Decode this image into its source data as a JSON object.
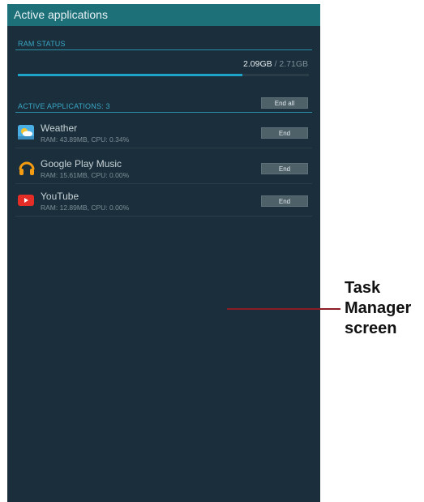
{
  "window": {
    "title": "Active applications"
  },
  "ram_status": {
    "header": "RAM STATUS",
    "used": "2.09GB",
    "separator": " / ",
    "total": "2.71GB",
    "usage_fraction": 0.771
  },
  "active_apps": {
    "header": "ACTIVE APPLICATIONS: 3",
    "end_all_label": "End all",
    "items": [
      {
        "name": "Weather",
        "stats": "RAM: 43.89MB, CPU: 0.34%",
        "end_label": "End",
        "icon": "weather-icon"
      },
      {
        "name": "Google Play Music",
        "stats": "RAM: 15.61MB, CPU: 0.00%",
        "end_label": "End",
        "icon": "headphones-icon"
      },
      {
        "name": "YouTube",
        "stats": "RAM: 12.89MB, CPU: 0.00%",
        "end_label": "End",
        "icon": "youtube-icon"
      }
    ]
  },
  "callout": {
    "line1": "Task",
    "line2": "Manager",
    "line3": "screen"
  },
  "colors": {
    "background": "#1a2f3b",
    "titlebar": "#1d6f78",
    "accent": "#1fa4c9",
    "callout_line": "#8c1c25"
  }
}
